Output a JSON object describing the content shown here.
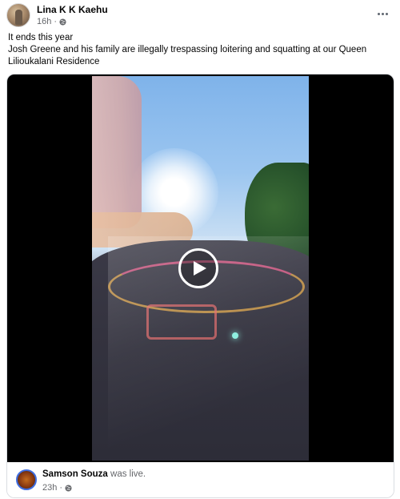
{
  "post": {
    "author_name": "Lina K K Kaehu",
    "time": "16h",
    "separator": "·",
    "audience_icon": "globe-icon",
    "more_icon": "more-horizontal-icon",
    "text_line1": "It ends this year",
    "text_line2": "Josh Greene and his family are illegally trespassing loitering and squatting at our Queen Lilioukalani Residence"
  },
  "video": {
    "play_icon": "play-icon"
  },
  "live": {
    "name": "Samson Souza",
    "status": " was live.",
    "time": "23h",
    "separator": "·",
    "audience_icon": "globe-icon"
  },
  "colors": {
    "text": "#050505",
    "secondary": "#65676b",
    "live_ring": "#3f6de0"
  }
}
